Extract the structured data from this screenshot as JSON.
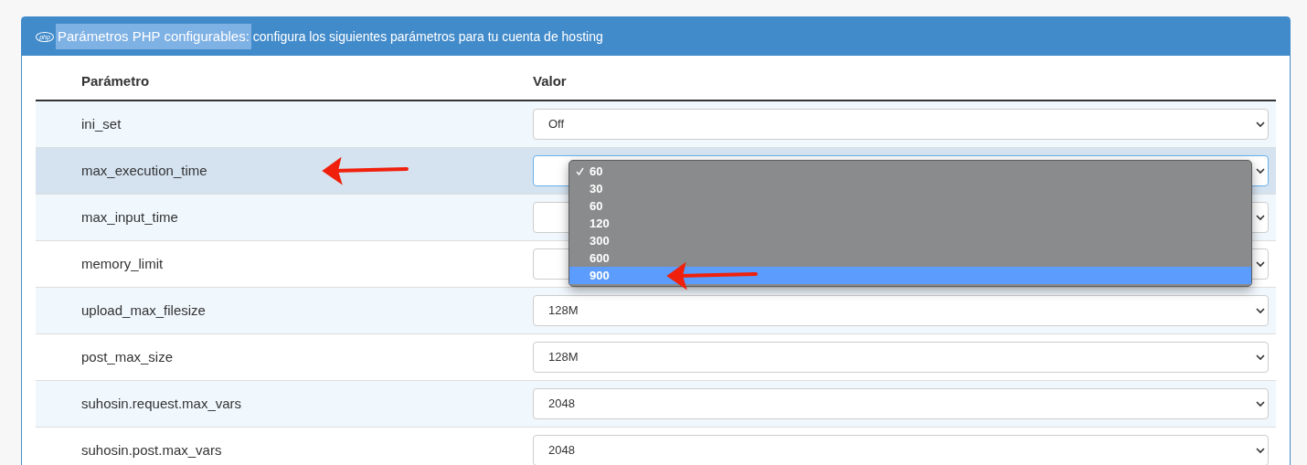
{
  "panel": {
    "logo_text": "php",
    "title": "Parámetros PHP configurables:",
    "title_text_selected": true,
    "subtitle": "configura los siguientes parámetros para tu cuenta de hosting"
  },
  "table": {
    "columns": [
      "Parámetro",
      "Valor"
    ],
    "rows": [
      {
        "name": "ini_set",
        "value": "Off",
        "highlighted": false,
        "arrow": false
      },
      {
        "name": "max_execution_time",
        "highlighted": true,
        "arrow": true
      },
      {
        "name": "max_input_time",
        "highlighted": false,
        "arrow": false
      },
      {
        "name": "memory_limit",
        "highlighted": false,
        "arrow": false
      },
      {
        "name": "upload_max_filesize",
        "value": "128M",
        "highlighted": false,
        "arrow": false
      },
      {
        "name": "post_max_size",
        "value": "128M",
        "highlighted": false,
        "arrow": false
      },
      {
        "name": "suhosin.request.max_vars",
        "value": "2048",
        "highlighted": false,
        "arrow": false
      },
      {
        "name": "suhosin.post.max_vars",
        "value": "2048",
        "highlighted": false,
        "arrow": false
      }
    ]
  },
  "dropdown": {
    "options": [
      {
        "label": "60",
        "checked": true,
        "highlighted": false,
        "arrow": false
      },
      {
        "label": "30",
        "checked": false,
        "highlighted": false,
        "arrow": false
      },
      {
        "label": "60",
        "checked": false,
        "highlighted": false,
        "arrow": false
      },
      {
        "label": "120",
        "checked": false,
        "highlighted": false,
        "arrow": false
      },
      {
        "label": "300",
        "checked": false,
        "highlighted": false,
        "arrow": false
      },
      {
        "label": "600",
        "checked": false,
        "highlighted": false,
        "arrow": false
      },
      {
        "label": "900",
        "checked": false,
        "highlighted": true,
        "arrow": true
      }
    ]
  }
}
